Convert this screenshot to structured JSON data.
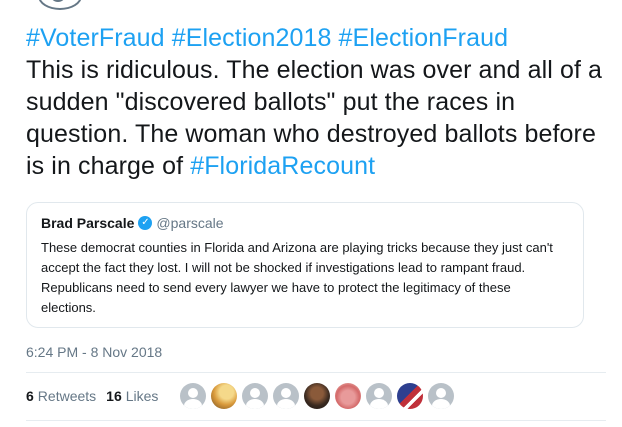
{
  "tweet": {
    "hashtags_line": [
      "#VoterFraud",
      "#Election2018",
      "#ElectionFraud"
    ],
    "body": "This is ridiculous. The election was over and all of a sudden \"discovered ballots\" put the races in question. The woman who destroyed ballots before is in charge of ",
    "trailing_hashtag": "#FloridaRecount"
  },
  "quote": {
    "name": "Brad Parscale",
    "handle": "@parscale",
    "text": "These democrat counties in Florida and Arizona are playing tricks because they just can't accept the fact they lost. I will not be shocked if investigations lead to rampant fraud. Republicans need to send every lawyer we have to protect the legitimacy of these elections."
  },
  "timestamp": "6:24 PM - 8 Nov 2018",
  "stats": {
    "retweets_count": "6",
    "retweets_label": "Retweets",
    "likes_count": "16",
    "likes_label": "Likes"
  },
  "liker_avatars": [
    "default",
    "sunset",
    "default",
    "default",
    "portrait",
    "pink",
    "default",
    "flag",
    "default"
  ],
  "colors": {
    "link": "#1da1f2",
    "text": "#14171a",
    "muted": "#657786",
    "border": "#e1e8ed"
  },
  "icons": {
    "verified": "verified-badge-icon"
  }
}
